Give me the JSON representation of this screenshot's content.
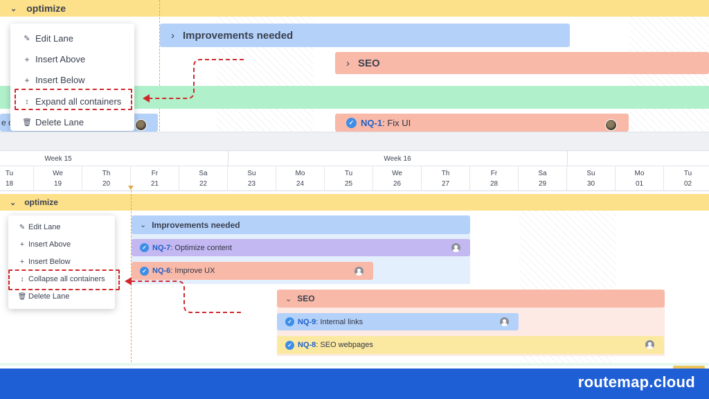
{
  "top": {
    "lane": {
      "title": "optimize",
      "chevron": "chevron-down-icon"
    },
    "menu": {
      "items": [
        {
          "label": "Edit Lane",
          "icon": "pencil-icon"
        },
        {
          "label": "Insert Above",
          "icon": "plus-icon"
        },
        {
          "label": "Insert Below",
          "icon": "plus-icon"
        },
        {
          "label": "Expand all containers",
          "icon": "expand-arrows-icon",
          "highlighted": true
        },
        {
          "label": "Delete Lane",
          "icon": "trash-icon"
        }
      ]
    },
    "groups": [
      {
        "label": "Improvements needed",
        "chevron": "chevron-right-icon",
        "color": "#b4d1f9"
      },
      {
        "label": "SEO",
        "chevron": "chevron-right-icon",
        "color": "#f9b9a8"
      }
    ],
    "cut_text": "e c",
    "task": {
      "key": "NQ-1",
      "title": ": Fix UI",
      "color": "#f9b9a8"
    }
  },
  "timeline": {
    "weeks": [
      "Week 15",
      "Week 16"
    ],
    "days": [
      {
        "name": "Tu",
        "date": "18"
      },
      {
        "name": "We",
        "date": "19"
      },
      {
        "name": "Th",
        "date": "20"
      },
      {
        "name": "Fr",
        "date": "21"
      },
      {
        "name": "Sa",
        "date": "22"
      },
      {
        "name": "Su",
        "date": "23"
      },
      {
        "name": "Mo",
        "date": "24"
      },
      {
        "name": "Tu",
        "date": "25"
      },
      {
        "name": "We",
        "date": "26"
      },
      {
        "name": "Th",
        "date": "27"
      },
      {
        "name": "Fr",
        "date": "28"
      },
      {
        "name": "Sa",
        "date": "29"
      },
      {
        "name": "Su",
        "date": "30"
      },
      {
        "name": "Mo",
        "date": "01"
      },
      {
        "name": "Tu",
        "date": "02"
      }
    ]
  },
  "bottom": {
    "lane": {
      "title": "optimize",
      "chevron": "chevron-down-icon"
    },
    "menu": {
      "items": [
        {
          "label": "Edit Lane",
          "icon": "pencil-icon"
        },
        {
          "label": "Insert Above",
          "icon": "plus-icon"
        },
        {
          "label": "Insert Below",
          "icon": "plus-icon"
        },
        {
          "label": "Collapse all containers",
          "icon": "collapse-arrows-icon",
          "highlighted": true
        },
        {
          "label": "Delete Lane",
          "icon": "trash-icon"
        }
      ]
    },
    "groups": [
      {
        "label": "Improvements needed",
        "chevron": "chevron-down-icon",
        "color": "#b4d1f9"
      },
      {
        "label": "SEO",
        "chevron": "chevron-down-icon",
        "color": "#f9b9a8"
      }
    ],
    "tasks": [
      {
        "key": "NQ-7",
        "title": ": Optimize content",
        "color": "#c3b8f1"
      },
      {
        "key": "NQ-6",
        "title": ": Improve UX",
        "color": "#f9b9a8"
      },
      {
        "key": "NQ-9",
        "title": ": Internal links",
        "color": "#b4d1f9"
      },
      {
        "key": "NQ-8",
        "title": ": SEO webpages",
        "color": "#fbe9a2"
      }
    ]
  },
  "footer": {
    "brand": "routemap.cloud"
  },
  "colors": {
    "lane": "#fde08a",
    "green_row": "#b0f0ca",
    "arrow": "#d0282b",
    "footer": "#1f5fd6",
    "today_line": "#e0a84a"
  }
}
